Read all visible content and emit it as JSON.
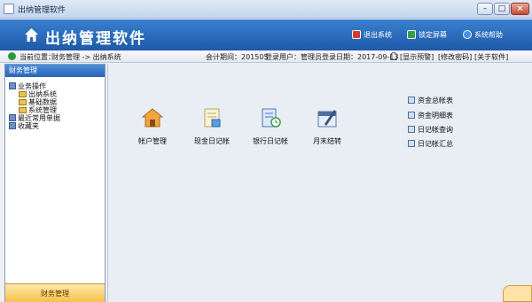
{
  "window": {
    "title": "出纳管理软件"
  },
  "header": {
    "app_title": "出纳管理软件",
    "buttons": {
      "exit": "退出系统",
      "lock": "锁定屏幕",
      "help": "系统帮助"
    }
  },
  "location_bar": {
    "label": "当前位置：",
    "path": "财务管理 -> 出纳系统",
    "period": "会计期间：201505",
    "user": "登录用户：管理员",
    "date": "登录日期：2017-09-13",
    "links": {
      "warnings": "[显示预警]",
      "change_password": "[修改密码]",
      "about": "[关于软件]"
    }
  },
  "sidebar": {
    "header": "财务管理",
    "tree": {
      "business_ops": "业务操作",
      "cashier_system": "出纳系统",
      "basic_data": "基础数据",
      "system_management": "系统管理",
      "recent_forms": "最近常用单据",
      "favorites": "收藏夹"
    },
    "footer": "财务管理"
  },
  "main": {
    "functions": {
      "account_management": "帐户管理",
      "cash_journal": "现金日记帐",
      "bank_journal": "银行日记帐",
      "month_end": "月末结转"
    },
    "reports": {
      "fund_summary": "资金总帐表",
      "fund_detail": "资金明细表",
      "journal_query": "日记帐查询",
      "journal_summary": "日记帐汇总"
    }
  },
  "colors": {
    "banner": "#1e5aa8",
    "sidebar_header": "#2a64b4",
    "footer": "#f5c14c"
  }
}
